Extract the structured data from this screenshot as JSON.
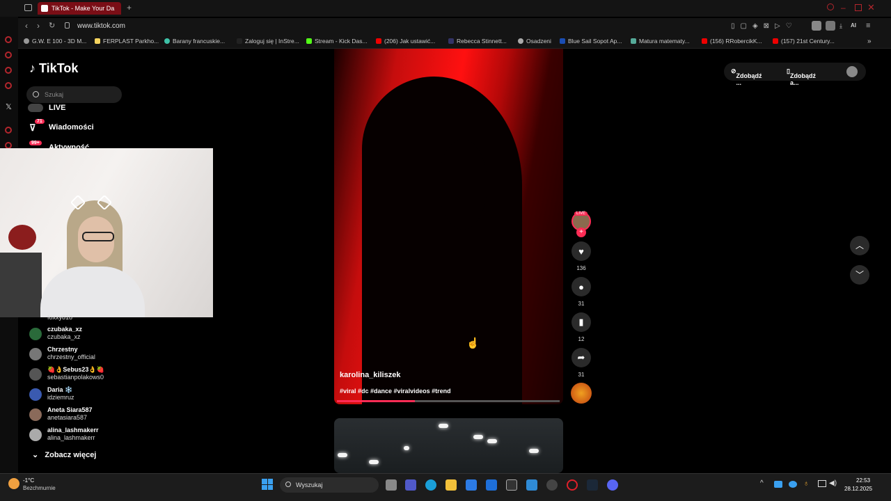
{
  "browser": {
    "tab_title": "TikTok - Make Your Da",
    "url": "www.tiktok.com",
    "bookmarks": [
      "G.W. E 100 - 3D M...",
      "FERPLAST Parkho...",
      "Barany francuskie...",
      "Zaloguj się | InStre...",
      "Stream - Kick Das...",
      "(206) Jak ustawić...",
      "Rebecca Stinnett...",
      "Osadzeni",
      "Blue Sail Sopot Ap...",
      "Matura matematy...",
      "(156) RRobercikK...",
      "(157) 21st Century..."
    ]
  },
  "tiktok": {
    "logo": "TikTok",
    "search_placeholder": "Szukaj",
    "nav": {
      "live": "LIVE",
      "messages": "Wiadomości",
      "messages_badge": "71",
      "activity": "Aktywność",
      "activity_badge": "99+"
    },
    "following": [
      {
        "name": "",
        "handle": "foxxy818"
      },
      {
        "name": "czubaka_xz",
        "handle": "czubaka_xz"
      },
      {
        "name": "Chrzestny",
        "handle": "chrzestny_official"
      },
      {
        "name": "🍓👌Sebus23👌🍓",
        "handle": "sebastianpolakows0"
      },
      {
        "name": "Daria ❄️",
        "handle": "idziemruz"
      },
      {
        "name": "Aneta Siara587",
        "handle": "anetasiara587"
      },
      {
        "name": "alina_lashmakerr",
        "handle": "alina_lashmakerr"
      }
    ],
    "see_more": "Zobacz więcej",
    "top_right": {
      "btn1": "Zdobądź ...",
      "btn2": "Zdobądź a..."
    },
    "video": {
      "author": "karolina_kiliszek",
      "tags": "#viral #dc #dance #viralvideos #trend",
      "progress": 0.35,
      "live_label": "LIVE",
      "likes": "136",
      "comments": "31",
      "saves": "12",
      "shares": "31"
    }
  },
  "taskbar": {
    "temp": "-1°C",
    "weather": "Bezchmurnie",
    "search": "Wyszukaj",
    "time": "22:53",
    "date": "28.12.2025"
  },
  "colors": {
    "accent": "#fe2c55",
    "tab_active": "#7a0e16"
  }
}
